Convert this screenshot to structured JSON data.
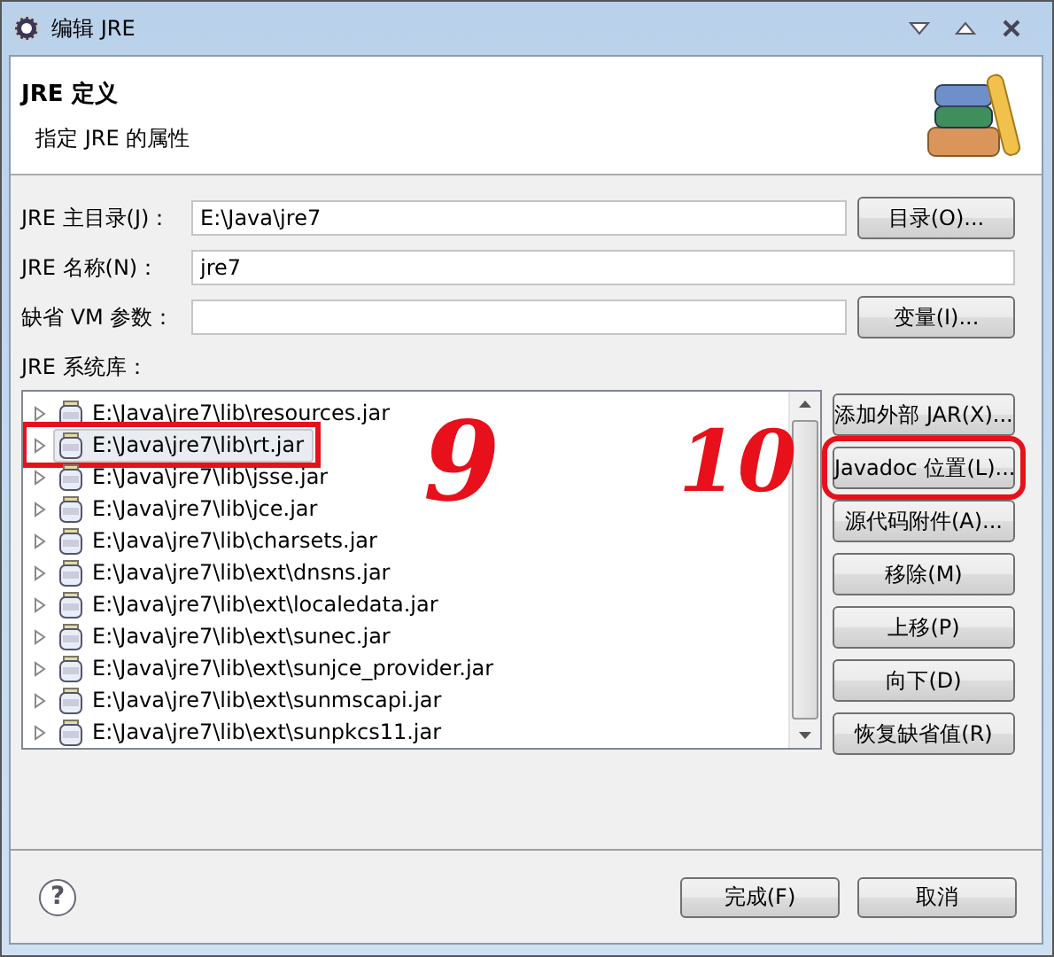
{
  "window": {
    "title": "编辑 JRE"
  },
  "header": {
    "title": "JRE 定义",
    "subtitle": "指定 JRE 的属性"
  },
  "fields": [
    {
      "label": "JRE 主目录(J)：",
      "value": "E:\\Java\\jre7",
      "button": "目录(O)..."
    },
    {
      "label": "JRE 名称(N)：",
      "value": "jre7"
    },
    {
      "label": "缺省 VM 参数：",
      "button": "变量(I)..."
    }
  ],
  "libraries": {
    "label": "JRE 系统库：",
    "items": [
      {
        "path": "E:\\Java\\jre7\\lib\\resources.jar",
        "selected": false,
        "annotated": false
      },
      {
        "path": "E:\\Java\\jre7\\lib\\rt.jar",
        "selected": true,
        "annotated": true
      },
      {
        "path": "E:\\Java\\jre7\\lib\\jsse.jar",
        "selected": false,
        "annotated": false
      },
      {
        "path": "E:\\Java\\jre7\\lib\\jce.jar",
        "selected": false,
        "annotated": false
      },
      {
        "path": "E:\\Java\\jre7\\lib\\charsets.jar",
        "selected": false,
        "annotated": false
      },
      {
        "path": "E:\\Java\\jre7\\lib\\ext\\dnsns.jar",
        "selected": false,
        "annotated": false
      },
      {
        "path": "E:\\Java\\jre7\\lib\\ext\\localedata.jar",
        "selected": false,
        "annotated": false
      },
      {
        "path": "E:\\Java\\jre7\\lib\\ext\\sunec.jar",
        "selected": false,
        "annotated": false
      },
      {
        "path": "E:\\Java\\jre7\\lib\\ext\\sunjce_provider.jar",
        "selected": false,
        "annotated": false
      },
      {
        "path": "E:\\Java\\jre7\\lib\\ext\\sunmscapi.jar",
        "selected": false,
        "annotated": false
      },
      {
        "path": "E:\\Java\\jre7\\lib\\ext\\sunpkcs11.jar",
        "selected": false,
        "annotated": false
      }
    ],
    "buttons": [
      {
        "label": "添加外部 JAR(X)...",
        "annotated": false
      },
      {
        "label": "Javadoc 位置(L)...",
        "annotated": true
      },
      {
        "label": "源代码附件(A)...",
        "annotated": false
      },
      {
        "label": "移除(M)",
        "annotated": false
      },
      {
        "label": "上移(P)",
        "annotated": false
      },
      {
        "label": "向下(D)",
        "annotated": false
      },
      {
        "label": "恢复缺省值(R)",
        "annotated": false
      }
    ]
  },
  "annotations": [
    {
      "label": "9"
    },
    {
      "label": "10"
    }
  ],
  "footer": {
    "help": "?",
    "buttons": [
      "完成(F)",
      "取消"
    ]
  }
}
